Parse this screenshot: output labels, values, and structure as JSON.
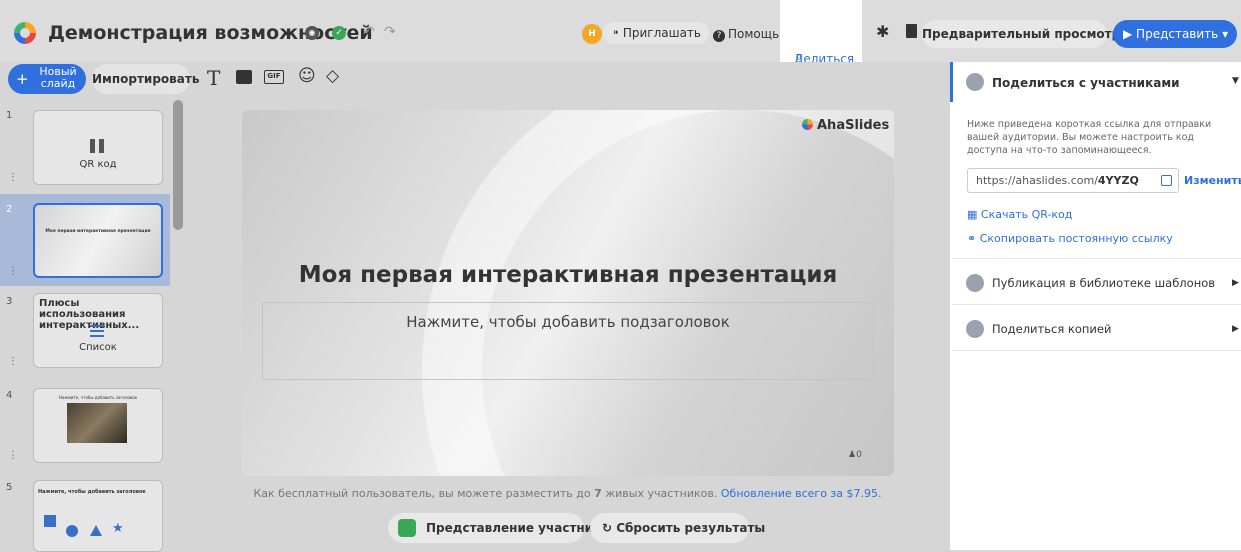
{
  "header": {
    "title": "Демонстрация возможностей",
    "avatar_initial": "Н",
    "invite_label": "Пригл­ашать",
    "help_label": "Помощь",
    "share_label": "Делиться",
    "preview_label": "Предварительный просмотр",
    "present_label": "Представить"
  },
  "toolbar": {
    "new_slide_label": "Новый слайд",
    "import_label": "Импортировать",
    "text_tool": "T",
    "gif_tool": "GIF"
  },
  "slides": [
    {
      "num": "1",
      "type_label": "QR код"
    },
    {
      "num": "2",
      "thumb_title": "Моя первая интерактивная презентация"
    },
    {
      "num": "3",
      "thumb_title": "Плюсы использования интерактивных...",
      "type_label": "Список"
    },
    {
      "num": "4",
      "thumb_title": "Нажмите, чтобы добавить заголовок"
    },
    {
      "num": "5",
      "thumb_title": "Нажмите, чтобы добавить заголовок"
    }
  ],
  "canvas": {
    "brand": "AhaSlides",
    "title": "Моя первая интерактивная презентация",
    "subtitle": "Нажмите, чтобы добавить подзаголовок",
    "counter": "0",
    "note_prefix": "Как бесплатный пользователь, вы можете разместить до ",
    "note_count": "7",
    "note_suffix": " живых участников. ",
    "note_link": "Обновление всего за $7.95.",
    "participant_view_label": "Представление участника",
    "reset_label": "Сбросить результаты"
  },
  "share_panel": {
    "header": "Поделиться с участниками",
    "description": "Ниже приведена короткая ссылка для отправки вашей аудитории. Вы можете настроить код доступа на что-то запоминающееся.",
    "link_prefix": "https://ahaslides.com/",
    "link_code": "4YYZQ",
    "change_label": "Изменить",
    "download_qr_label": "Скачать QR-код",
    "copy_link_label": "Скопировать постоянную ссылку",
    "publish_label": "Публикация в библиотеке шаблонов",
    "share_copy_label": "Поделиться копией"
  },
  "colors": {
    "accent": "#2f6fde",
    "success": "#3aa657",
    "avatar": "#f5a623"
  }
}
